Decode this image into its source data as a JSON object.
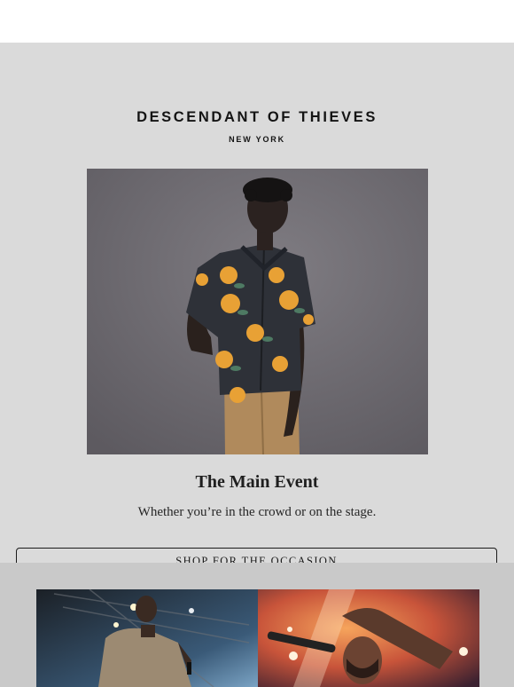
{
  "brand": {
    "name": "DESCENDANT OF THIEVES",
    "location": "NEW YORK"
  },
  "hero": {
    "image": "model-in-floral-shirt"
  },
  "headline": "The Main Event",
  "subline": "Whether you’re in the crowd or on the stage.",
  "cta": {
    "label": "SHOP FOR THE OCCASION"
  },
  "gallery": {
    "images": [
      "performer-on-stage-left",
      "performer-singing-right"
    ]
  },
  "colors": {
    "background": "#dadada",
    "section2": "#c9c9c9",
    "text": "#1b1b1b"
  }
}
